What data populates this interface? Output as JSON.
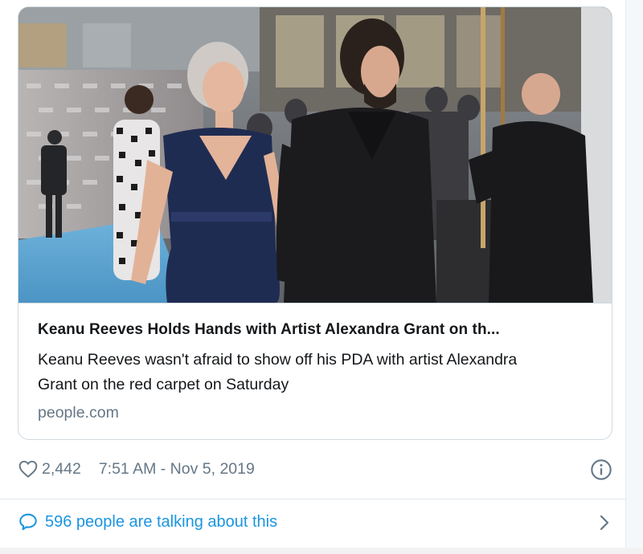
{
  "card": {
    "image_alt": "",
    "title": "Keanu Reeves Holds Hands with Artist Alexandra Grant on th...",
    "description": "Keanu Reeves wasn't afraid to show off his PDA with artist Alexandra Grant on the red carpet on Saturday",
    "domain": "people.com"
  },
  "meta": {
    "like_icon": "heart-icon",
    "like_count": "2,442",
    "timestamp": "7:51 AM - Nov 5, 2019",
    "info_icon": "info-icon"
  },
  "conversation": {
    "icon": "speech-bubble-icon",
    "label": "596 people are talking about this",
    "chevron_icon": "chevron-right-icon"
  },
  "colors": {
    "link_blue": "#1b95e0",
    "muted_gray": "#657786",
    "border": "#cfd9de",
    "carpet_blue": "#5fa9d6"
  }
}
